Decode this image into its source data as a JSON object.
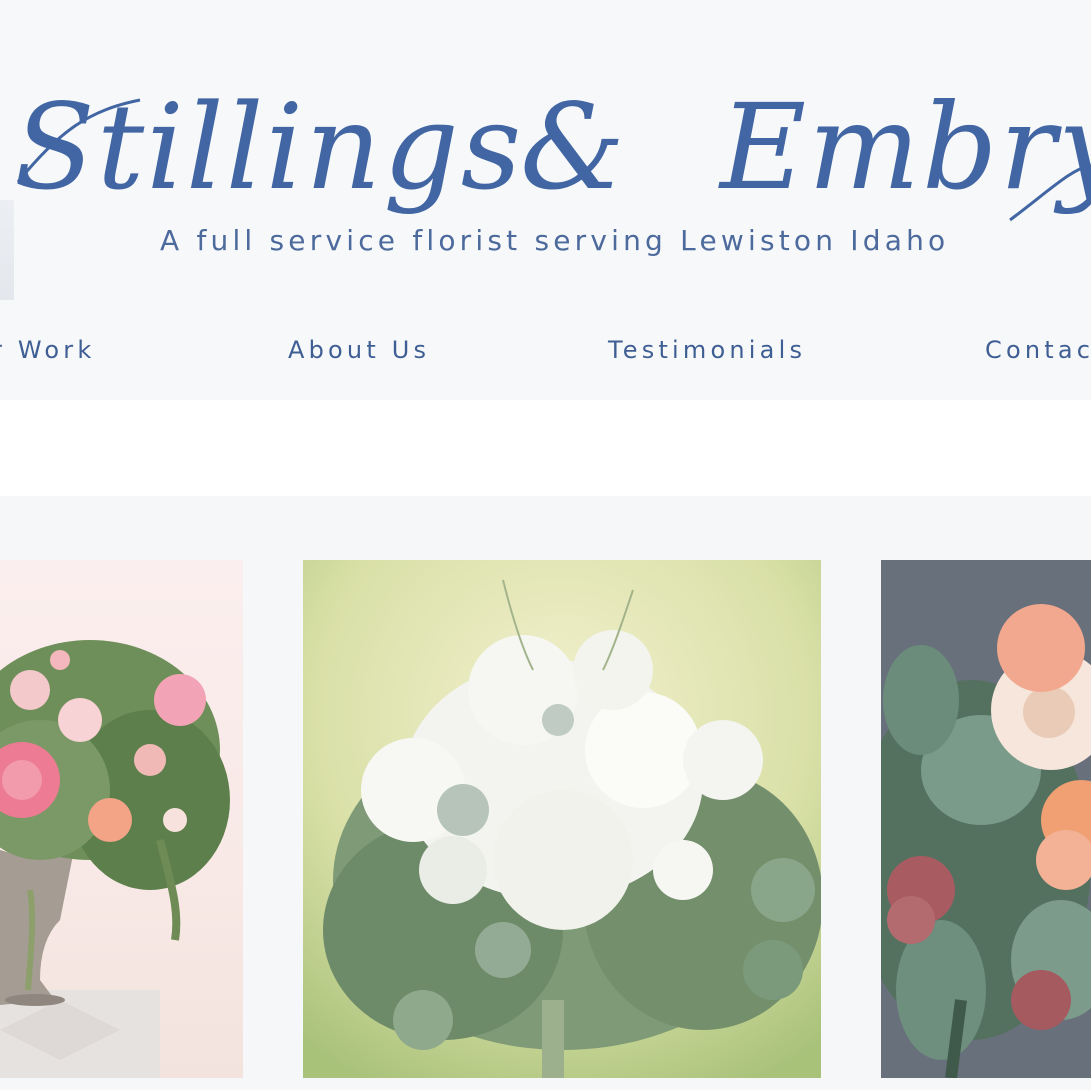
{
  "brand": {
    "logo_text": "Stillings & Embry",
    "tagline": "A full service florist serving Lewiston Idaho"
  },
  "nav": {
    "items": [
      {
        "label": "r Work"
      },
      {
        "label": "About Us"
      },
      {
        "label": "Testimonials"
      },
      {
        "label": "Contac"
      }
    ]
  },
  "gallery": {
    "items": [
      {
        "subject": "pink-peony-centerpiece"
      },
      {
        "subject": "white-bridal-bouquet"
      },
      {
        "subject": "peach-ranunculus-eucalyptus-bouquet"
      }
    ]
  },
  "colors": {
    "brand_blue": "#3f5f94",
    "banner_bg": "#f7f8fa",
    "gallery_bg": "#f6f7f9"
  }
}
